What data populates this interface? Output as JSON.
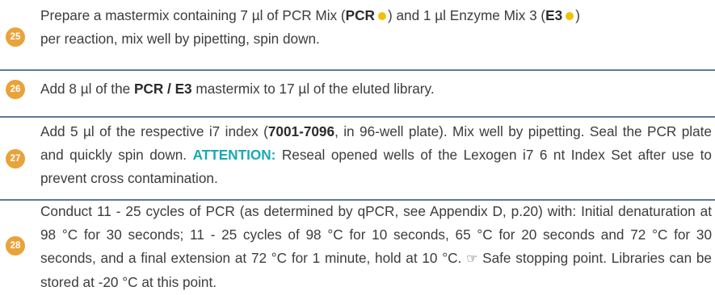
{
  "colors": {
    "badge": "#e8a33a",
    "rule": "#5b7a96",
    "reagent_dot": "#f2c200",
    "attention": "#1aa9b5"
  },
  "steps": [
    {
      "number": "25",
      "parts": {
        "a": "Prepare a mastermix containing 7 µl of PCR Mix (",
        "b": "PCR",
        "c": ") and 1 µl Enzyme Mix 3 (",
        "d": "E3",
        "e": ")",
        "f": "per reaction, mix well by pipetting, spin down."
      }
    },
    {
      "number": "26",
      "parts": {
        "a": "Add 8 µl of the ",
        "b": "PCR / E3",
        "c": " mastermix to 17 µl of the eluted library."
      }
    },
    {
      "number": "27",
      "parts": {
        "a": "Add 5 µl of the respective i7 index (",
        "b": "7001-7096",
        "c": ", in 96-well plate). Mix well by pipetting. Seal the PCR plate and quickly spin down. ",
        "d": "ATTENTION:",
        "e": " Reseal opened wells of the Lexogen i7 6 nt Index Set after use to prevent cross contamination."
      }
    },
    {
      "number": "28",
      "parts": {
        "a": "Conduct 11 - 25 cycles of PCR (as determined by qPCR, see Appendix D, p.20) with: Initial denaturation at 98 °C for 30 seconds; 11 - 25 cycles of 98 °C for 10 seconds, 65 °C for 20 seconds and 72 °C for 30 seconds, and a final extension at 72 °C for 1 minute, hold at 10 °C. ",
        "b": " Safe stopping point. Libraries can be stored at -20 °C at this point."
      }
    }
  ]
}
